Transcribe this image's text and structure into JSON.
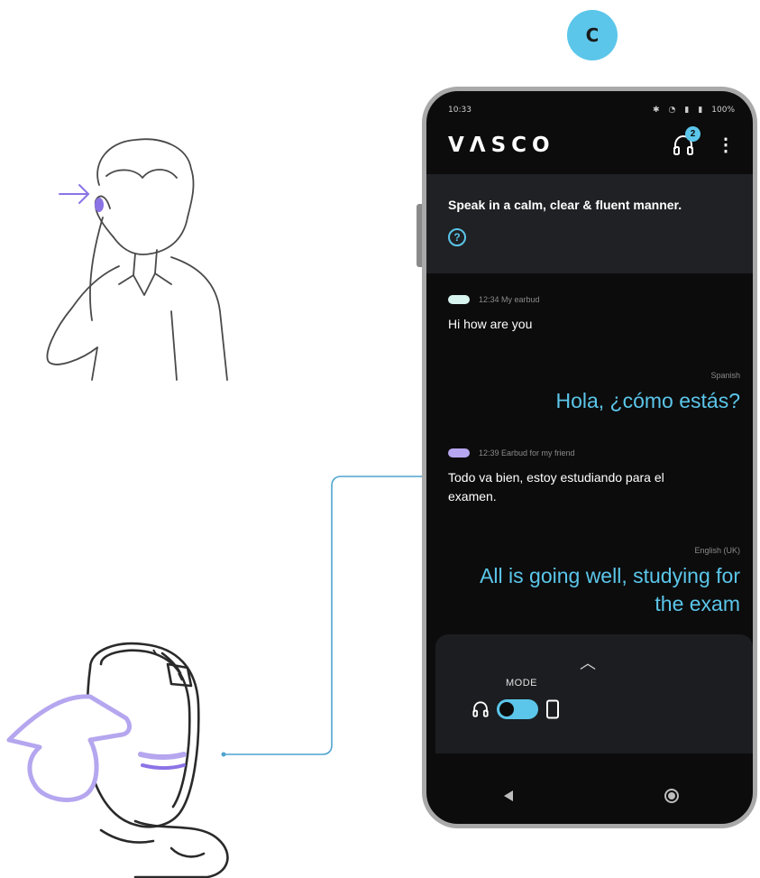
{
  "step_badge": "C",
  "phone": {
    "status": {
      "time": "10:33",
      "battery": "100%"
    },
    "appbar": {
      "logo": "VΛSCO",
      "connected_count": "2"
    },
    "tip": {
      "text": "Speak in a calm, clear & fluent manner.",
      "help_glyph": "?"
    },
    "messages": [
      {
        "pill_color": "#d7f4ef",
        "meta": "12:34 My earbud",
        "text": "Hi how are you",
        "language": "Spanish",
        "translation": "Hola, ¿cómo estás?"
      },
      {
        "pill_color": "#b7a7f0",
        "meta": "12:39 Earbud for my friend",
        "text": "Todo va bien, estoy estudiando para el examen.",
        "language": "English (UK)",
        "translation": "All is going well, studying for the exam"
      }
    ],
    "mode": {
      "label": "MODE",
      "selected": "earbud"
    },
    "accent": "#5bc6ea"
  }
}
